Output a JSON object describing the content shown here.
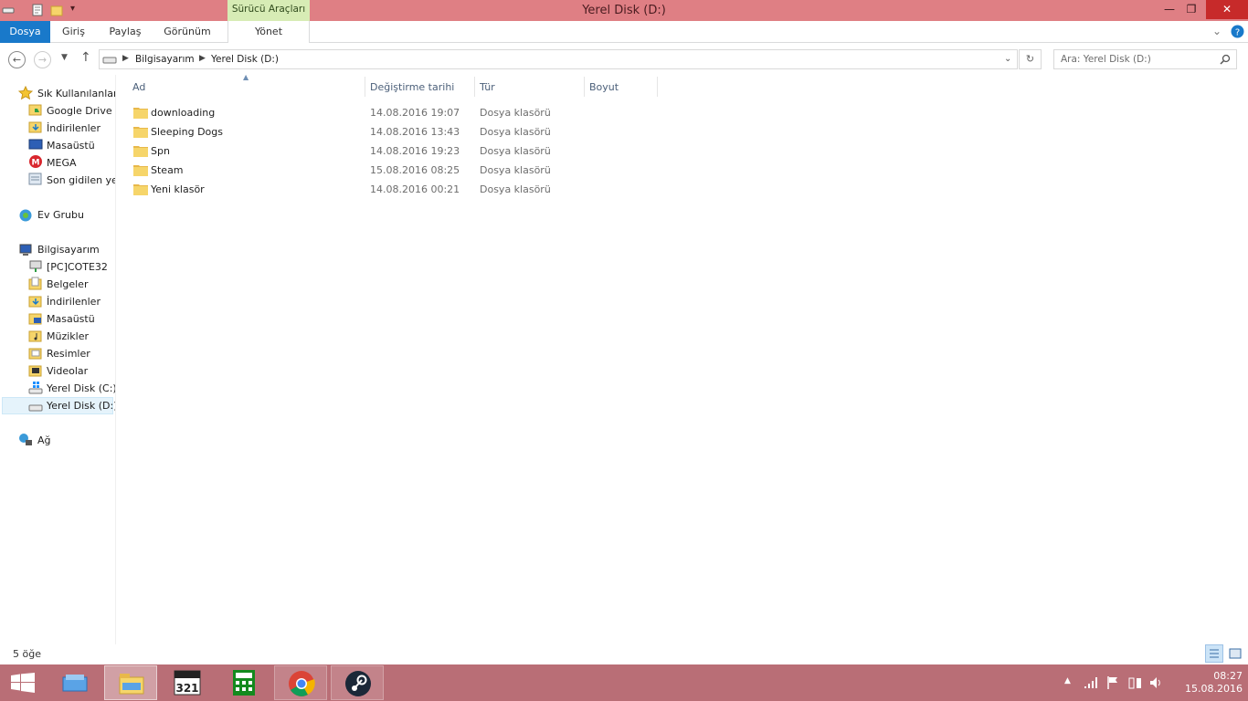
{
  "window": {
    "title": "Yerel Disk (D:)",
    "context_tab_group": "Sürücü Araçları",
    "controls": {
      "minimize": "—",
      "maximize": "❐",
      "close": "✕"
    }
  },
  "ribbon": {
    "tabs": [
      "Dosya",
      "Giriş",
      "Paylaş",
      "Görünüm"
    ],
    "context_tab": "Yönet"
  },
  "navbar": {
    "breadcrumb": [
      "Bilgisayarım",
      "Yerel Disk (D:)"
    ],
    "search_placeholder": "Ara: Yerel Disk (D:)"
  },
  "navpane": {
    "favorites": {
      "label": "Sık Kullanılanlar",
      "items": [
        "Google Drive",
        "İndirilenler",
        "Masaüstü",
        "MEGA",
        "Son gidilen ye"
      ]
    },
    "homegroup": "Ev Grubu",
    "computer": {
      "label": "Bilgisayarım",
      "items": [
        "[PC]COTE32",
        "Belgeler",
        "İndirilenler",
        "Masaüstü",
        "Müzikler",
        "Resimler",
        "Videolar",
        "Yerel Disk (C:)",
        "Yerel Disk (D:)"
      ]
    },
    "network": "Ağ"
  },
  "columns": [
    "Ad",
    "Değiştirme tarihi",
    "Tür",
    "Boyut"
  ],
  "files": [
    {
      "name": "downloading",
      "date": "14.08.2016 19:07",
      "type": "Dosya klasörü"
    },
    {
      "name": "Sleeping Dogs",
      "date": "14.08.2016 13:43",
      "type": "Dosya klasörü"
    },
    {
      "name": "Spn",
      "date": "14.08.2016 19:23",
      "type": "Dosya klasörü"
    },
    {
      "name": "Steam",
      "date": "15.08.2016 08:25",
      "type": "Dosya klasörü"
    },
    {
      "name": "Yeni klasör",
      "date": "14.08.2016 00:21",
      "type": "Dosya klasörü"
    }
  ],
  "status": {
    "count": "5 öğe"
  },
  "taskbar": {
    "time": "08:27",
    "date": "15.08.2016",
    "apps": [
      "windows-explorer",
      "file-explorer",
      "media-player-classic",
      "calculator",
      "chrome",
      "steam"
    ]
  },
  "colors": {
    "titlebar": "#df7f84",
    "accent": "#1979ca",
    "taskbar": "#b96e76",
    "context_tab": "#d7ecb5"
  }
}
